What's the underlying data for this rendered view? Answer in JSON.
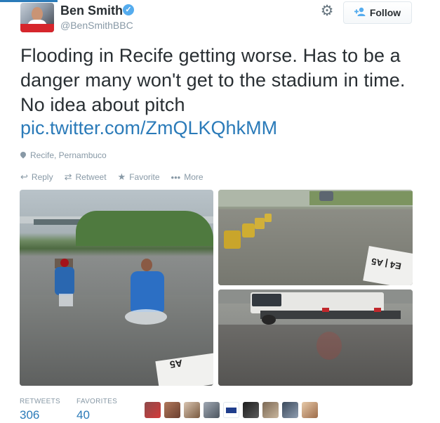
{
  "user": {
    "name": "Ben Smith",
    "handle": "@BenSmithBBC",
    "verified_glyph": "✓"
  },
  "header": {
    "follow_label": "Follow",
    "follow_icon": "person-plus-icon",
    "settings_icon": "gear-icon"
  },
  "tweet": {
    "text": "Flooding in Recife getting worse. Has to be a danger many won't get to the stadium in time. No idea about pitch",
    "link": "pic.twitter.com/ZmQLKQhkMM",
    "location": "Recife, Pernambuco"
  },
  "actions": {
    "reply": "Reply",
    "retweet": "Retweet",
    "favorite": "Favorite",
    "more": "More"
  },
  "stats": {
    "retweets_label": "RETWEETS",
    "retweets_value": "306",
    "favorites_label": "FAVORITES",
    "favorites_value": "40"
  },
  "photos": {
    "p1_sign": "A5",
    "p2_sign": "E4 | A5"
  },
  "colors": {
    "link": "#2b7bb9",
    "muted": "#8899a6",
    "text": "#292f33",
    "verified": "#55acee"
  }
}
